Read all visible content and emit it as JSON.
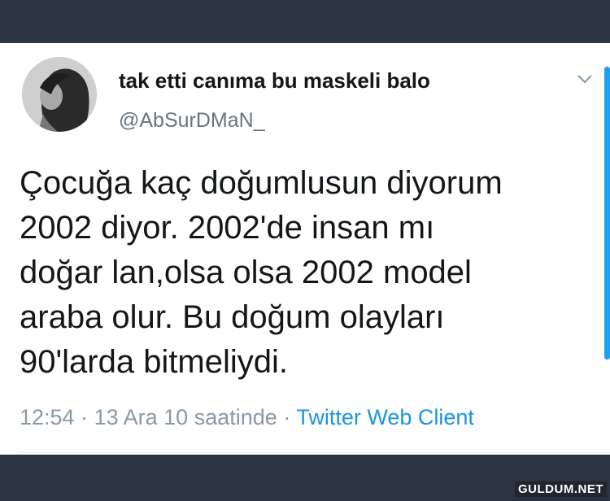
{
  "tweet": {
    "display_name": "tak etti canıma bu maskeli balo",
    "handle": "@AbSurDMaN_",
    "text_lines": [
      "Çocuğa kaç doğumlusun diyorum",
      "2002 diyor. 2002'de insan mı",
      "doğar lan,olsa olsa 2002 model",
      "araba olur. Bu doğum olayları",
      "90'larda bitmeliydi."
    ],
    "time": "12:54",
    "date": "13 Ara 10 saatinde",
    "separator": "·",
    "source": "Twitter Web Client",
    "icons": {
      "caret": "chevron-down-icon",
      "avatar": "profile-photo"
    }
  },
  "watermark": "GULDUM.NET",
  "colors": {
    "background_dark": "#2b3340",
    "card": "#ffffff",
    "text": "#14171a",
    "muted": "#66757f",
    "link": "#1b95e0"
  }
}
